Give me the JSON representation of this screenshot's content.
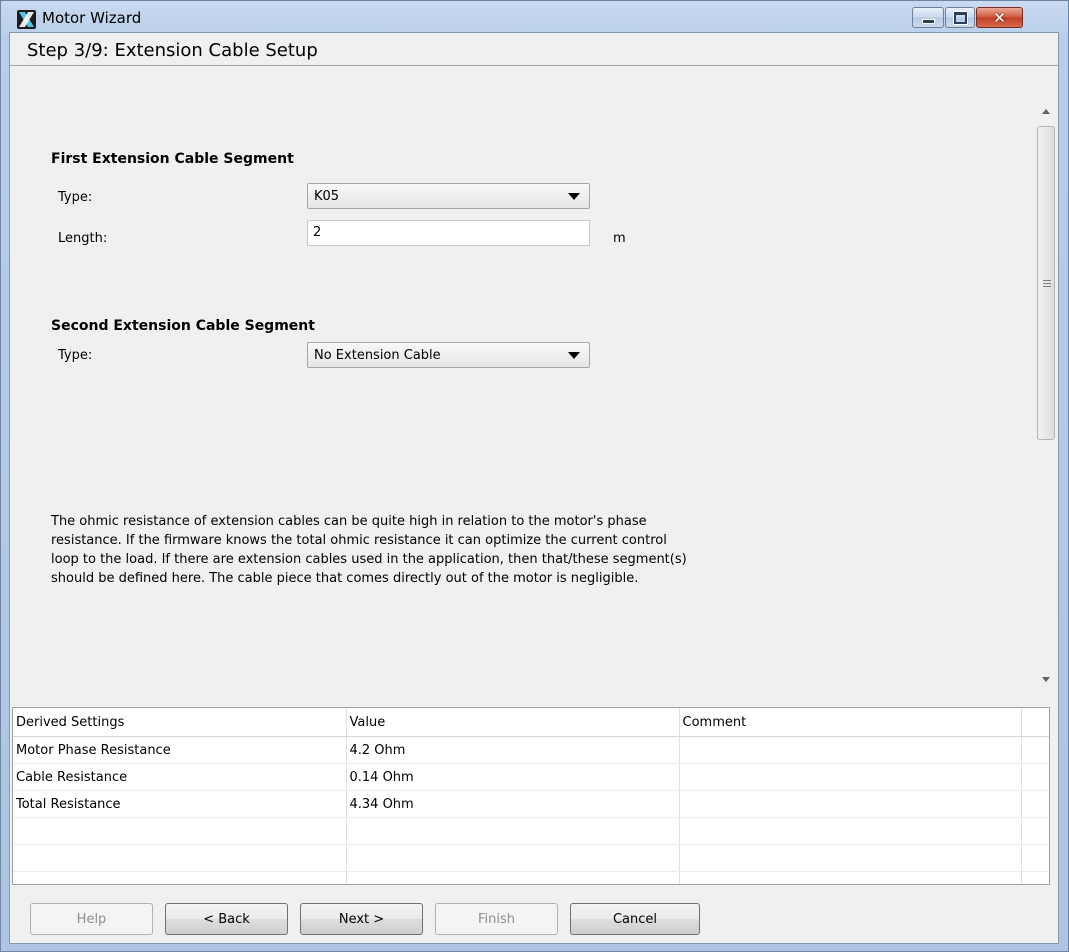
{
  "window": {
    "title": "Motor Wizard"
  },
  "step": {
    "title": "Step 3/9: Extension Cable Setup"
  },
  "first_segment": {
    "heading": "First Extension Cable Segment",
    "type_label": "Type:",
    "type_value": "K05",
    "length_label": "Length:",
    "length_value": "2",
    "length_unit": "m"
  },
  "second_segment": {
    "heading": "Second Extension Cable Segment",
    "type_label": "Type:",
    "type_value": "No Extension Cable"
  },
  "info_text": "The ohmic resistance of extension cables can be quite high in relation to the motor's phase\nresistance. If the firmware knows the total ohmic resistance it can optimize the current control\nloop to the load. If there are extension cables used in the application, then that/these segment(s)\nshould be defined here. The cable piece that comes directly out of the motor is negligible.",
  "table": {
    "headers": [
      "Derived Settings",
      "Value",
      "Comment"
    ],
    "rows": [
      {
        "setting": "Motor Phase Resistance",
        "value": "4.2 Ohm",
        "comment": ""
      },
      {
        "setting": "Cable Resistance",
        "value": "0.14 Ohm",
        "comment": ""
      },
      {
        "setting": "Total Resistance",
        "value": "4.34 Ohm",
        "comment": ""
      }
    ]
  },
  "buttons": {
    "help": "Help",
    "back": "< Back",
    "next": "Next >",
    "finish": "Finish",
    "cancel": "Cancel"
  }
}
